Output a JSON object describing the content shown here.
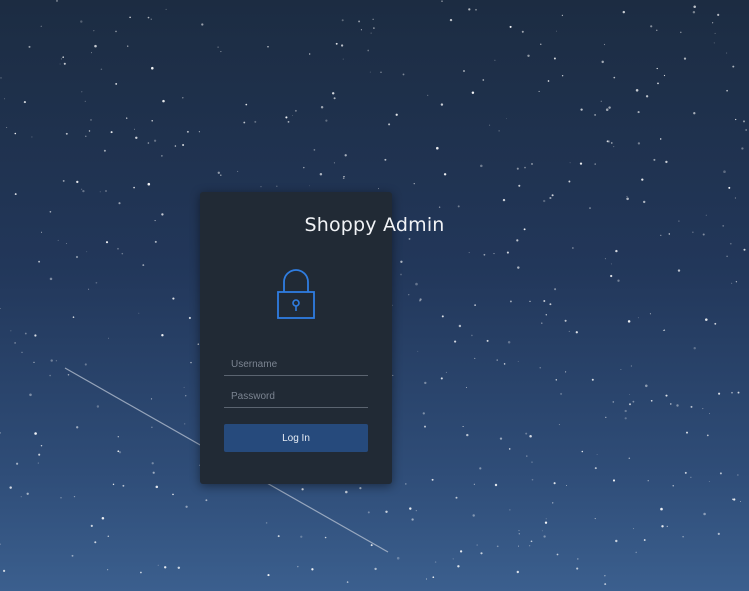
{
  "login": {
    "title": "Shoppy Admin",
    "username_placeholder": "Username",
    "password_placeholder": "Password",
    "login_label": "Log In"
  },
  "icons": {
    "lock": "lock-icon"
  },
  "colors": {
    "card_background": "#212a35",
    "accent": "#2f7de1",
    "button_background": "#264a7c",
    "background_top": "#1c2c42",
    "background_bottom": "#3b5f8e"
  }
}
